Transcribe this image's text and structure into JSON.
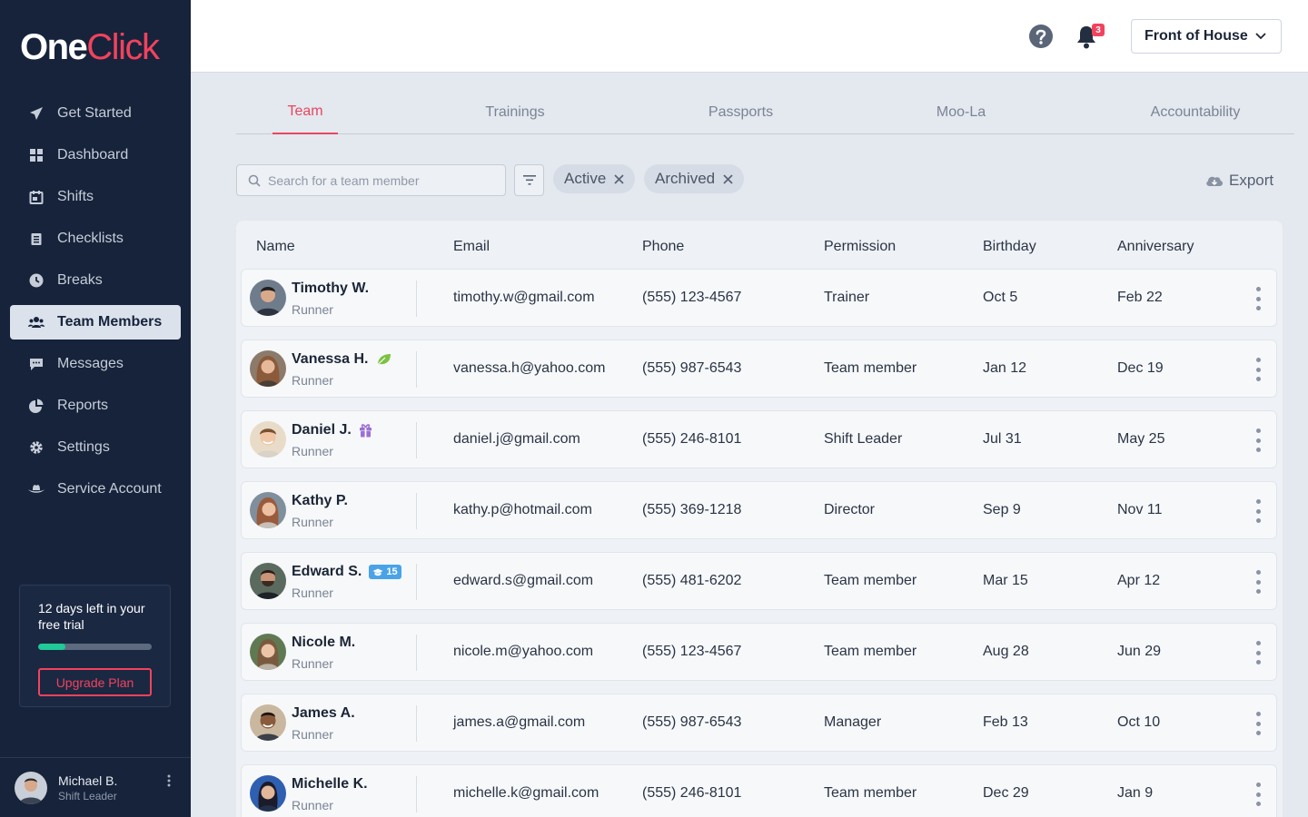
{
  "brand": {
    "part1": "One",
    "part2": "Click"
  },
  "sidebar": {
    "items": [
      {
        "label": "Get Started",
        "icon": "paper-plane-icon"
      },
      {
        "label": "Dashboard",
        "icon": "grid-icon"
      },
      {
        "label": "Shifts",
        "icon": "calendar-icon"
      },
      {
        "label": "Checklists",
        "icon": "clipboard-icon"
      },
      {
        "label": "Breaks",
        "icon": "clock-icon"
      },
      {
        "label": "Team Members",
        "icon": "users-icon",
        "active": true
      },
      {
        "label": "Messages",
        "icon": "chat-icon"
      },
      {
        "label": "Reports",
        "icon": "pie-chart-icon"
      },
      {
        "label": "Settings",
        "icon": "gear-icon"
      },
      {
        "label": "Service Account",
        "icon": "cowboy-hat-icon"
      }
    ],
    "trial": {
      "text": "12 days left in your free trial",
      "progress": 0.24,
      "button": "Upgrade Plan"
    },
    "profile": {
      "name": "Michael B.",
      "role": "Shift Leader"
    }
  },
  "header": {
    "notification_count": "3",
    "location": "Front of House"
  },
  "tabs": [
    "Team",
    "Trainings",
    "Passports",
    "Moo-La",
    "Accountability"
  ],
  "filters": {
    "search_placeholder": "Search for a team member",
    "chips": [
      "Active",
      "Archived"
    ],
    "export_label": "Export"
  },
  "table": {
    "columns": [
      "Name",
      "Email",
      "Phone",
      "Permission",
      "Birthday",
      "Anniversary"
    ],
    "rows": [
      {
        "name": "Timothy W.",
        "role": "Runner",
        "email": "timothy.w@gmail.com",
        "phone": "(555) 123-4567",
        "permission": "Trainer",
        "birthday": "Oct 5",
        "anniversary": "Feb 22",
        "badge": ""
      },
      {
        "name": "Vanessa H.",
        "role": "Runner",
        "email": "vanessa.h@yahoo.com",
        "phone": "(555) 987-6543",
        "permission": "Team member",
        "birthday": "Jan 12",
        "anniversary": "Dec 19",
        "badge": "leaf-icon"
      },
      {
        "name": "Daniel J.",
        "role": "Runner",
        "email": "daniel.j@gmail.com",
        "phone": "(555) 246-8101",
        "permission": "Shift Leader",
        "birthday": "Jul 31",
        "anniversary": "May 25",
        "badge": "gift-icon"
      },
      {
        "name": "Kathy P.",
        "role": "Runner",
        "email": "kathy.p@hotmail.com",
        "phone": "(555) 369-1218",
        "permission": "Director",
        "birthday": "Sep 9",
        "anniversary": "Nov 11",
        "badge": ""
      },
      {
        "name": "Edward S.",
        "role": "Runner",
        "email": "edward.s@gmail.com",
        "phone": "(555) 481-6202",
        "permission": "Team member",
        "birthday": "Mar 15",
        "anniversary": "Apr 12",
        "badge": "graduation-cap-icon",
        "badge_text": "15"
      },
      {
        "name": "Nicole M.",
        "role": "Runner",
        "email": "nicole.m@yahoo.com",
        "phone": "(555) 123-4567",
        "permission": "Team member",
        "birthday": "Aug 28",
        "anniversary": "Jun 29",
        "badge": ""
      },
      {
        "name": "James A.",
        "role": "Runner",
        "email": "james.a@gmail.com",
        "phone": "(555) 987-6543",
        "permission": "Manager",
        "birthday": "Feb 13",
        "anniversary": "Oct 10",
        "badge": ""
      },
      {
        "name": "Michelle K.",
        "role": "Runner",
        "email": "michelle.k@gmail.com",
        "phone": "(555) 246-8101",
        "permission": "Team member",
        "birthday": "Dec 29",
        "anniversary": "Jan 9",
        "badge": ""
      }
    ]
  },
  "colors": {
    "sidebar_bg": "#16233b",
    "accent": "#f2425d",
    "progress": "#20c997"
  }
}
